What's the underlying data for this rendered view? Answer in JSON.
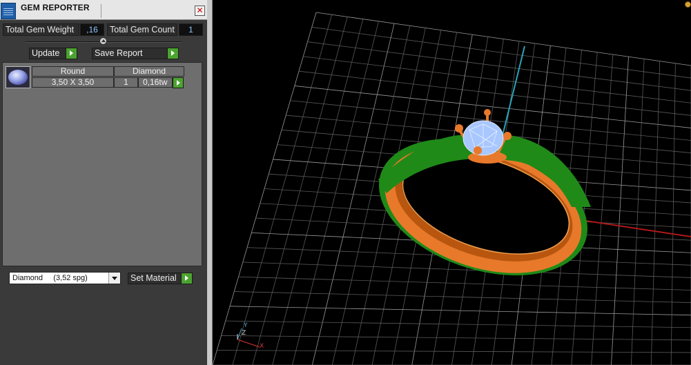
{
  "window": {
    "title": "GEM REPORTER",
    "close_label": "✕"
  },
  "summary": {
    "total_weight_label": "Total Gem Weight",
    "total_weight_value": ",16",
    "total_count_label": "Total Gem Count",
    "total_count_value": "1"
  },
  "toolbar": {
    "update_label": "Update",
    "save_report_label": "Save Report"
  },
  "gem_list": {
    "rows": [
      {
        "shape": "Round",
        "type": "Diamond",
        "size": "3,50 X 3,50",
        "qty": "1",
        "weight": "0,16tw"
      }
    ]
  },
  "material": {
    "selected": "Diamond     (3,52 spg)",
    "set_label": "Set Material"
  },
  "viewport": {
    "axis_x": "X",
    "axis_y": "Y",
    "axis_z": "Z"
  },
  "colors": {
    "panel_bg": "#3a3a3a",
    "accent_green": "#4ba32f",
    "value_text": "#8ec8ff",
    "ring_metal": "#e8792a",
    "ring_green": "#1f8a18",
    "gem_blue": "#a9c7ff"
  },
  "icons": [
    "gem-reporter-app-icon",
    "close-icon",
    "slider-knob-icon",
    "play-arrow-icon",
    "dropdown-chevron-icon"
  ]
}
